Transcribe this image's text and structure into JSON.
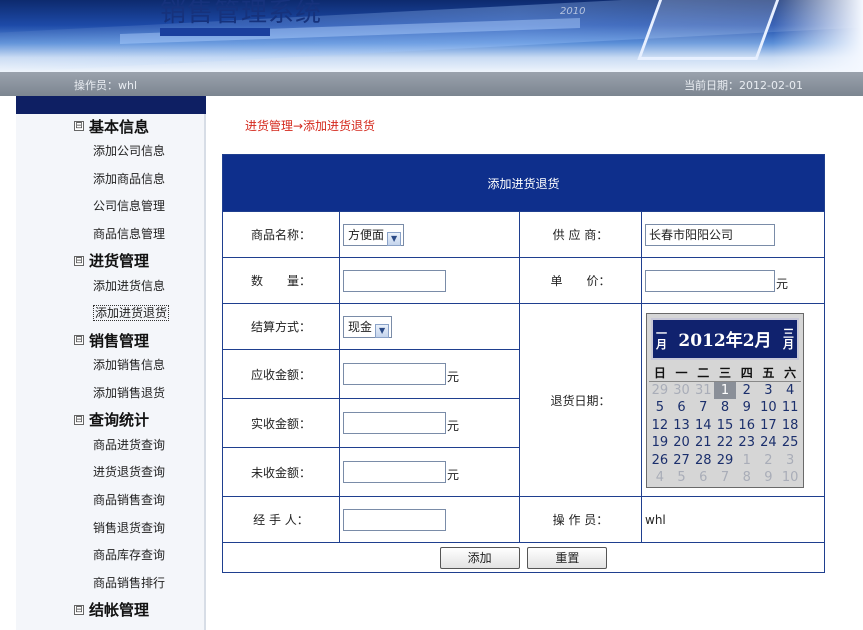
{
  "app": {
    "title": "销售管理系统",
    "banner_faint": "2010",
    "operator": "操作员：whl",
    "current_date": "当前日期：2012-02-01"
  },
  "sidebar": {
    "groups": [
      {
        "label": "基本信息",
        "items": [
          "添加公司信息",
          "添加商品信息",
          "公司信息管理",
          "商品信息管理"
        ]
      },
      {
        "label": "进货管理",
        "items": [
          "添加进货信息",
          "添加进货退货"
        ]
      },
      {
        "label": "销售管理",
        "items": [
          "添加销售信息",
          "添加销售退货"
        ]
      },
      {
        "label": "查询统计",
        "items": [
          "商品进货查询",
          "进货退货查询",
          "商品销售查询",
          "销售退货查询",
          "商品库存查询",
          "商品销售排行"
        ]
      },
      {
        "label": "结帐管理",
        "items": []
      }
    ],
    "active_item": "添加进货退货",
    "toggle_symbol": "⊟"
  },
  "breadcrumb": "进货管理→添加进货退货",
  "form": {
    "title": "添加进货退货",
    "product_label": "商品名称：",
    "product_value": "方便面",
    "supplier_label": "供 应 商：",
    "supplier_value": "长春市阳阳公司",
    "qty_label": "数　　量：",
    "qty_value": "",
    "price_label": "单　　价：",
    "price_value": "",
    "price_unit": "元",
    "settle_label": "结算方式：",
    "settle_value": "现金",
    "receivable_label": "应收金额：",
    "receivable_value": "",
    "received_label": "实收金额：",
    "received_value": "",
    "outstanding_label": "未收金额：",
    "outstanding_value": "",
    "yuan": "元",
    "return_date_label": "退货日期：",
    "handler_label": "经 手 人：",
    "handler_value": "",
    "operator_label": "操 作 员：",
    "operator_value": "whl",
    "add_button": "添加",
    "reset_button": "重置"
  },
  "calendar": {
    "prev": "一月",
    "next": "三月",
    "prev_top": "一",
    "prev_bottom": "月",
    "next_top": "三",
    "next_bottom": "月",
    "month_label": "2012年2月",
    "dows": [
      "日",
      "一",
      "二",
      "三",
      "四",
      "五",
      "六"
    ],
    "weeks": [
      [
        "29",
        "30",
        "31",
        "1",
        "2",
        "3",
        "4"
      ],
      [
        "5",
        "6",
        "7",
        "8",
        "9",
        "10",
        "11"
      ],
      [
        "12",
        "13",
        "14",
        "15",
        "16",
        "17",
        "18"
      ],
      [
        "19",
        "20",
        "21",
        "22",
        "23",
        "24",
        "25"
      ],
      [
        "26",
        "27",
        "28",
        "29",
        "1",
        "2",
        "3"
      ],
      [
        "4",
        "5",
        "6",
        "7",
        "8",
        "9",
        "10"
      ]
    ],
    "selected_day": "1",
    "colors": {
      "header_bg": "#10226e",
      "day_text": "#1b2f6c",
      "dim_text": "#a9adb8",
      "selected_bg": "#8a8f98"
    }
  },
  "colors": {
    "table_header": "#0e2f8c",
    "breadcrumb": "#d4281c",
    "sidebar_top": "#0e1f63"
  }
}
